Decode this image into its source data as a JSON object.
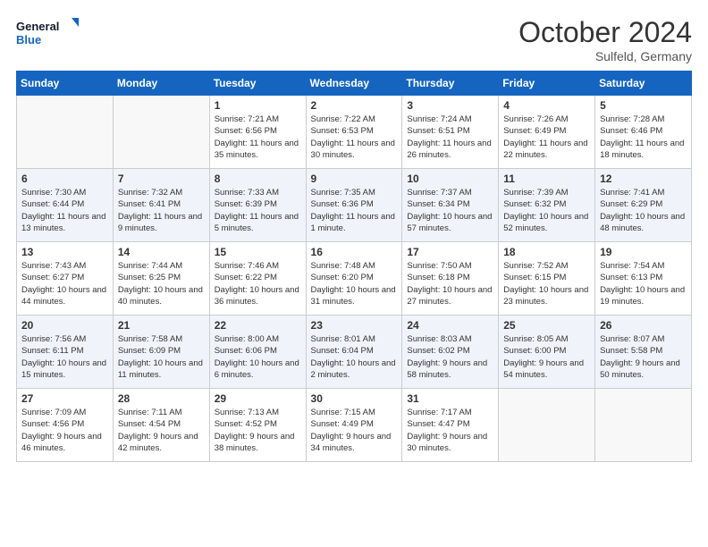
{
  "logo": {
    "line1": "General",
    "line2": "Blue"
  },
  "title": "October 2024",
  "location": "Sulfeld, Germany",
  "weekdays": [
    "Sunday",
    "Monday",
    "Tuesday",
    "Wednesday",
    "Thursday",
    "Friday",
    "Saturday"
  ],
  "weeks": [
    [
      {
        "day": "",
        "sunrise": "",
        "sunset": "",
        "daylight": ""
      },
      {
        "day": "",
        "sunrise": "",
        "sunset": "",
        "daylight": ""
      },
      {
        "day": "1",
        "sunrise": "Sunrise: 7:21 AM",
        "sunset": "Sunset: 6:56 PM",
        "daylight": "Daylight: 11 hours and 35 minutes."
      },
      {
        "day": "2",
        "sunrise": "Sunrise: 7:22 AM",
        "sunset": "Sunset: 6:53 PM",
        "daylight": "Daylight: 11 hours and 30 minutes."
      },
      {
        "day": "3",
        "sunrise": "Sunrise: 7:24 AM",
        "sunset": "Sunset: 6:51 PM",
        "daylight": "Daylight: 11 hours and 26 minutes."
      },
      {
        "day": "4",
        "sunrise": "Sunrise: 7:26 AM",
        "sunset": "Sunset: 6:49 PM",
        "daylight": "Daylight: 11 hours and 22 minutes."
      },
      {
        "day": "5",
        "sunrise": "Sunrise: 7:28 AM",
        "sunset": "Sunset: 6:46 PM",
        "daylight": "Daylight: 11 hours and 18 minutes."
      }
    ],
    [
      {
        "day": "6",
        "sunrise": "Sunrise: 7:30 AM",
        "sunset": "Sunset: 6:44 PM",
        "daylight": "Daylight: 11 hours and 13 minutes."
      },
      {
        "day": "7",
        "sunrise": "Sunrise: 7:32 AM",
        "sunset": "Sunset: 6:41 PM",
        "daylight": "Daylight: 11 hours and 9 minutes."
      },
      {
        "day": "8",
        "sunrise": "Sunrise: 7:33 AM",
        "sunset": "Sunset: 6:39 PM",
        "daylight": "Daylight: 11 hours and 5 minutes."
      },
      {
        "day": "9",
        "sunrise": "Sunrise: 7:35 AM",
        "sunset": "Sunset: 6:36 PM",
        "daylight": "Daylight: 11 hours and 1 minute."
      },
      {
        "day": "10",
        "sunrise": "Sunrise: 7:37 AM",
        "sunset": "Sunset: 6:34 PM",
        "daylight": "Daylight: 10 hours and 57 minutes."
      },
      {
        "day": "11",
        "sunrise": "Sunrise: 7:39 AM",
        "sunset": "Sunset: 6:32 PM",
        "daylight": "Daylight: 10 hours and 52 minutes."
      },
      {
        "day": "12",
        "sunrise": "Sunrise: 7:41 AM",
        "sunset": "Sunset: 6:29 PM",
        "daylight": "Daylight: 10 hours and 48 minutes."
      }
    ],
    [
      {
        "day": "13",
        "sunrise": "Sunrise: 7:43 AM",
        "sunset": "Sunset: 6:27 PM",
        "daylight": "Daylight: 10 hours and 44 minutes."
      },
      {
        "day": "14",
        "sunrise": "Sunrise: 7:44 AM",
        "sunset": "Sunset: 6:25 PM",
        "daylight": "Daylight: 10 hours and 40 minutes."
      },
      {
        "day": "15",
        "sunrise": "Sunrise: 7:46 AM",
        "sunset": "Sunset: 6:22 PM",
        "daylight": "Daylight: 10 hours and 36 minutes."
      },
      {
        "day": "16",
        "sunrise": "Sunrise: 7:48 AM",
        "sunset": "Sunset: 6:20 PM",
        "daylight": "Daylight: 10 hours and 31 minutes."
      },
      {
        "day": "17",
        "sunrise": "Sunrise: 7:50 AM",
        "sunset": "Sunset: 6:18 PM",
        "daylight": "Daylight: 10 hours and 27 minutes."
      },
      {
        "day": "18",
        "sunrise": "Sunrise: 7:52 AM",
        "sunset": "Sunset: 6:15 PM",
        "daylight": "Daylight: 10 hours and 23 minutes."
      },
      {
        "day": "19",
        "sunrise": "Sunrise: 7:54 AM",
        "sunset": "Sunset: 6:13 PM",
        "daylight": "Daylight: 10 hours and 19 minutes."
      }
    ],
    [
      {
        "day": "20",
        "sunrise": "Sunrise: 7:56 AM",
        "sunset": "Sunset: 6:11 PM",
        "daylight": "Daylight: 10 hours and 15 minutes."
      },
      {
        "day": "21",
        "sunrise": "Sunrise: 7:58 AM",
        "sunset": "Sunset: 6:09 PM",
        "daylight": "Daylight: 10 hours and 11 minutes."
      },
      {
        "day": "22",
        "sunrise": "Sunrise: 8:00 AM",
        "sunset": "Sunset: 6:06 PM",
        "daylight": "Daylight: 10 hours and 6 minutes."
      },
      {
        "day": "23",
        "sunrise": "Sunrise: 8:01 AM",
        "sunset": "Sunset: 6:04 PM",
        "daylight": "Daylight: 10 hours and 2 minutes."
      },
      {
        "day": "24",
        "sunrise": "Sunrise: 8:03 AM",
        "sunset": "Sunset: 6:02 PM",
        "daylight": "Daylight: 9 hours and 58 minutes."
      },
      {
        "day": "25",
        "sunrise": "Sunrise: 8:05 AM",
        "sunset": "Sunset: 6:00 PM",
        "daylight": "Daylight: 9 hours and 54 minutes."
      },
      {
        "day": "26",
        "sunrise": "Sunrise: 8:07 AM",
        "sunset": "Sunset: 5:58 PM",
        "daylight": "Daylight: 9 hours and 50 minutes."
      }
    ],
    [
      {
        "day": "27",
        "sunrise": "Sunrise: 7:09 AM",
        "sunset": "Sunset: 4:56 PM",
        "daylight": "Daylight: 9 hours and 46 minutes."
      },
      {
        "day": "28",
        "sunrise": "Sunrise: 7:11 AM",
        "sunset": "Sunset: 4:54 PM",
        "daylight": "Daylight: 9 hours and 42 minutes."
      },
      {
        "day": "29",
        "sunrise": "Sunrise: 7:13 AM",
        "sunset": "Sunset: 4:52 PM",
        "daylight": "Daylight: 9 hours and 38 minutes."
      },
      {
        "day": "30",
        "sunrise": "Sunrise: 7:15 AM",
        "sunset": "Sunset: 4:49 PM",
        "daylight": "Daylight: 9 hours and 34 minutes."
      },
      {
        "day": "31",
        "sunrise": "Sunrise: 7:17 AM",
        "sunset": "Sunset: 4:47 PM",
        "daylight": "Daylight: 9 hours and 30 minutes."
      },
      {
        "day": "",
        "sunrise": "",
        "sunset": "",
        "daylight": ""
      },
      {
        "day": "",
        "sunrise": "",
        "sunset": "",
        "daylight": ""
      }
    ]
  ]
}
